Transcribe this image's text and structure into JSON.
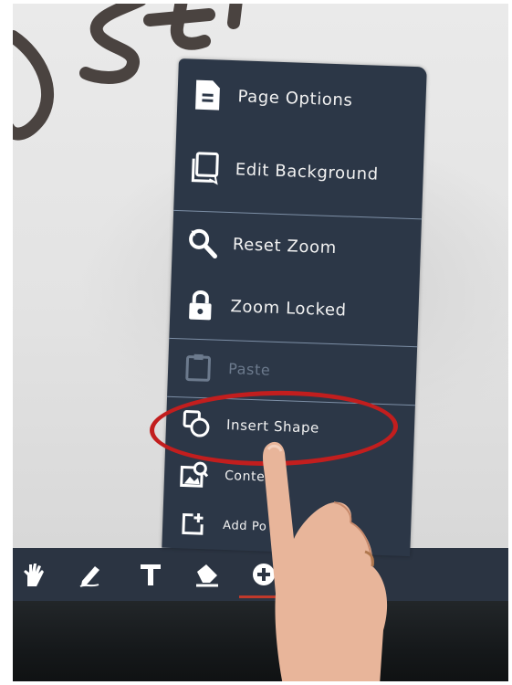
{
  "menu": {
    "items": [
      {
        "label": "Page Options",
        "icon": "page-icon"
      },
      {
        "label": "Edit Background",
        "icon": "background-icon"
      },
      {
        "label": "Reset Zoom",
        "icon": "zoom-reset-icon"
      },
      {
        "label": "Zoom Locked",
        "icon": "lock-icon"
      },
      {
        "label": "Paste",
        "icon": "clipboard-icon"
      },
      {
        "label": "Insert Shape",
        "icon": "shape-icon"
      },
      {
        "label": "Conte",
        "icon": "image-search-icon"
      },
      {
        "label": "Add Po",
        "icon": "add-page-icon"
      }
    ]
  },
  "toolbar": {
    "tools": [
      "hand-icon",
      "pen-icon",
      "text-icon",
      "eraser-icon",
      "add-icon"
    ]
  },
  "colors": {
    "menu_bg": "#2c3747",
    "toolbar_bg": "#2b3442",
    "highlight": "#c21e1e",
    "accent": "#c0392b"
  }
}
